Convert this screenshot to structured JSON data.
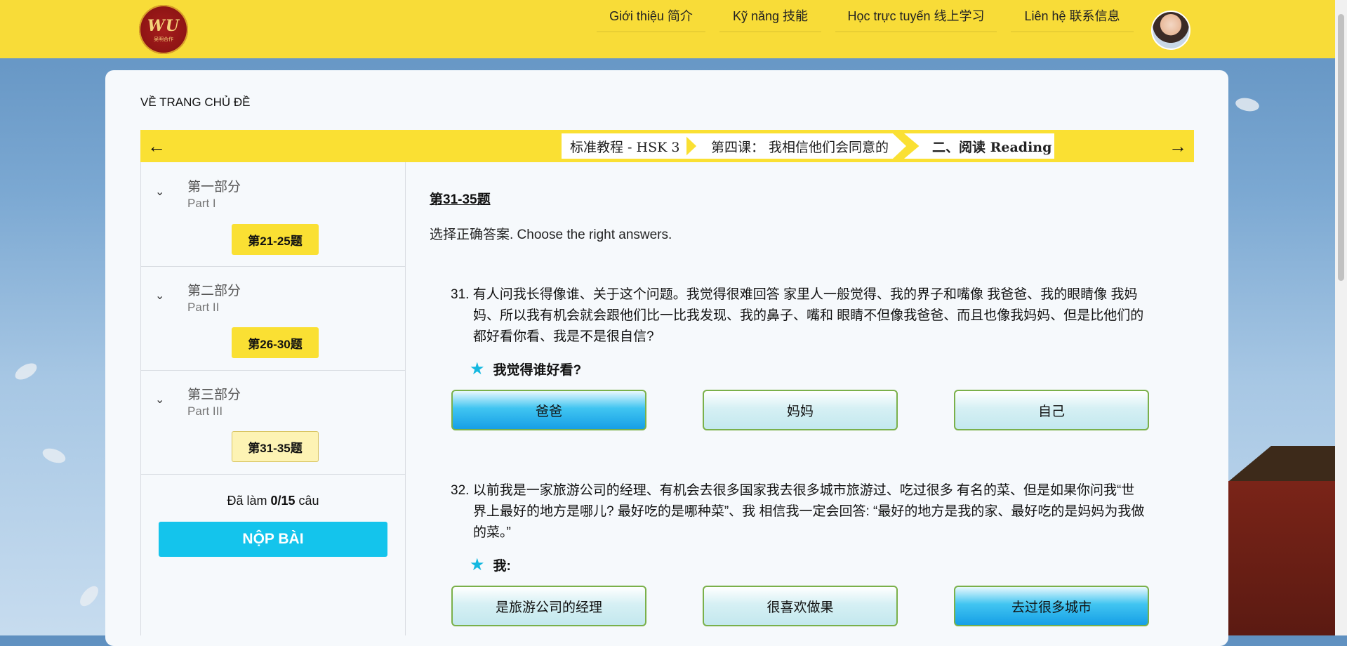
{
  "header": {
    "logo_text": "WU",
    "logo_sub": "吴明合作",
    "nav": [
      {
        "label": "Giới thiệu 简介"
      },
      {
        "label": "Kỹ năng 技能"
      },
      {
        "label": "Học trực tuyến 线上学习"
      },
      {
        "label": "Liên hệ 联系信息"
      }
    ]
  },
  "back_link": "VỀ TRANG CHỦ ĐỀ",
  "breadcrumb": {
    "items": [
      "标准教程 - HSK 3",
      "第四课： 我相信他们会同意的",
      "二、阅读 Reading"
    ]
  },
  "sidebar": {
    "sections": [
      {
        "title": "第一部分",
        "subtitle": "Part I",
        "button": "第21-25题"
      },
      {
        "title": "第二部分",
        "subtitle": "Part II",
        "button": "第26-30题"
      },
      {
        "title": "第三部分",
        "subtitle": "Part III",
        "button": "第31-35题"
      }
    ],
    "progress_prefix": "Đã làm ",
    "progress_value": "0/15",
    "progress_suffix": " câu",
    "submit_label": "NỘP BÀI"
  },
  "content": {
    "heading": "第31-35题",
    "instruction": "选择正确答案. Choose the right answers.",
    "questions": [
      {
        "text": "31. 有人问我长得像谁、关于这个问题。我觉得很难回答 家里人一般觉得、我的界子和嘴像 我爸爸、我的眼睛像 我妈妈、所以我有机会就会跟他们比一比我发现、我的鼻子、嘴和 眼睛不但像我爸爸、而且也像我妈妈、但是比他们的都好看你看、我是不是很自信?",
        "prompt": "我觉得谁好看?",
        "options": [
          "爸爸",
          "妈妈",
          "自己"
        ]
      },
      {
        "text": "32. 以前我是一家旅游公司的经理、有机会去很多国家我去很多城市旅游过、吃过很多 有名的菜、但是如果你问我“世界上最好的地方是哪儿? 最好吃的是哪种菜”、我 相信我一定会回答: “最好的地方是我的家、最好吃的是妈妈为我做的菜。”",
        "prompt": "我:",
        "options": [
          "是旅游公司的经理",
          "很喜欢做果",
          "去过很多城市"
        ]
      }
    ]
  }
}
